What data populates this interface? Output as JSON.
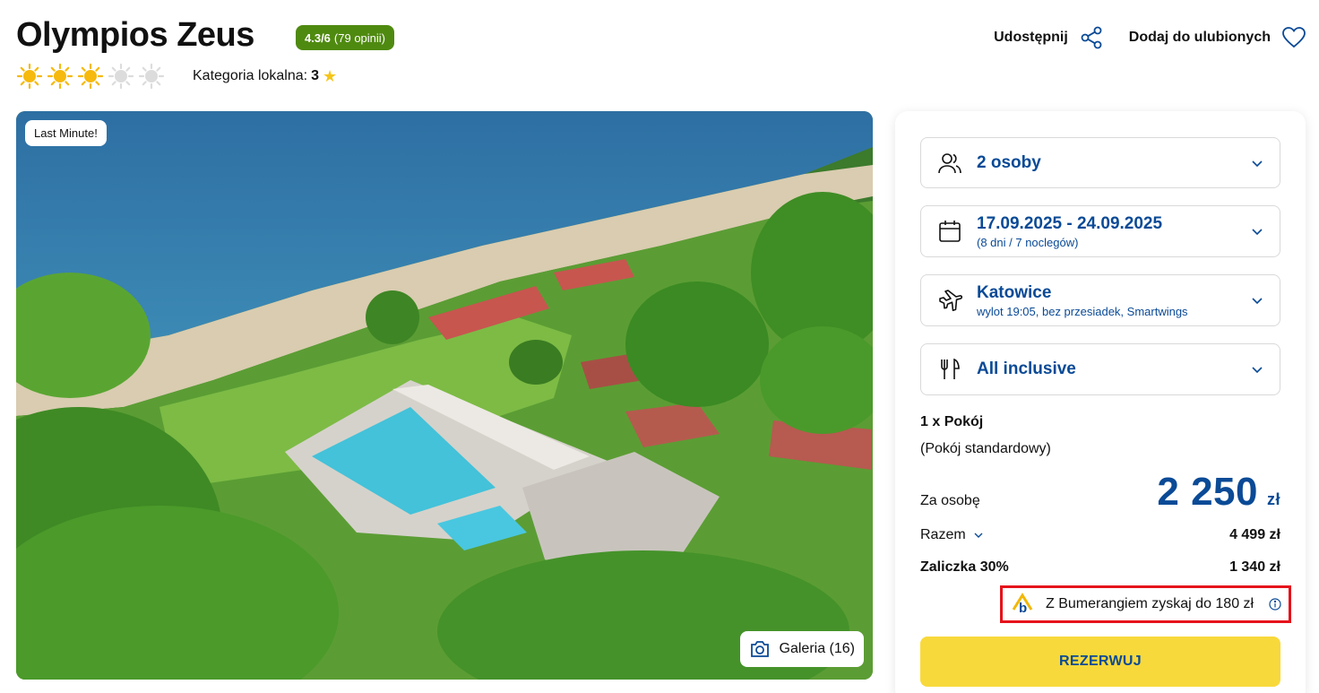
{
  "hotel": {
    "name": "Olympios Zeus",
    "rating_score": "4.3/6",
    "rating_reviews": "(79 opinii)",
    "stars_filled": 3,
    "stars_total": 5,
    "local_category_label": "Kategoria lokalna:",
    "local_category_value": "3"
  },
  "actions": {
    "share": "Udostępnij",
    "favorite": "Dodaj do ulubionych"
  },
  "photo": {
    "tag": "Last Minute!",
    "gallery_label": "Galeria (16)"
  },
  "booking": {
    "persons": "2 osoby",
    "dates": "17.09.2025 - 24.09.2025",
    "dates_sub": "(8 dni / 7 noclegów)",
    "departure": "Katowice",
    "departure_sub": "wylot 19:05, bez przesiadek, Smartwings",
    "board": "All inclusive",
    "room_count": "1 x Pokój",
    "room_type": "(Pokój standardowy)",
    "per_person_label": "Za osobę",
    "per_person_price": "2 250",
    "currency": "zł",
    "total_label": "Razem",
    "total_value": "4 499 zł",
    "deposit_label": "Zaliczka 30%",
    "deposit_value": "1 340 zł",
    "bumerang_text": "Z Bumerangiem zyskaj do 180 zł",
    "book_label": "REZERWUJ"
  },
  "colors": {
    "brand_blue": "#0a4a96",
    "rating_green": "#4f8a10",
    "cta_yellow": "#f8d93b",
    "highlight_red": "#e5131b"
  }
}
